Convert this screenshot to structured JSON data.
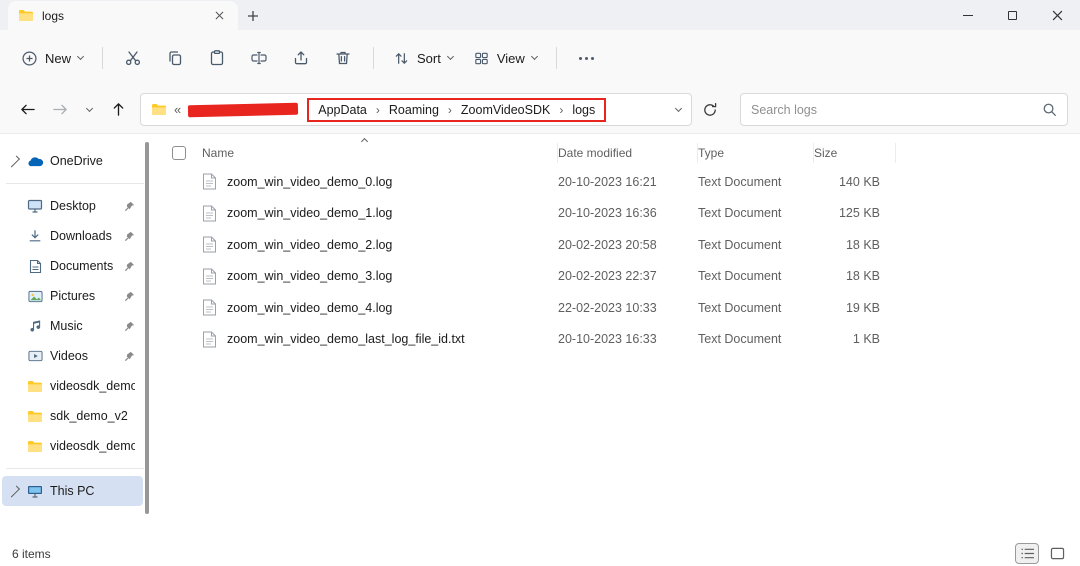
{
  "window": {
    "tab_title": "logs"
  },
  "toolbar": {
    "new_label": "New",
    "sort_label": "Sort",
    "view_label": "View"
  },
  "address": {
    "overflow_indicator": "«",
    "breadcrumbs": [
      "AppData",
      "Roaming",
      "ZoomVideoSDK",
      "logs"
    ],
    "separator": "›",
    "search_placeholder": "Search logs"
  },
  "sidebar": {
    "items": [
      {
        "label": "OneDrive"
      },
      {
        "label": "Desktop"
      },
      {
        "label": "Downloads"
      },
      {
        "label": "Documents"
      },
      {
        "label": "Pictures"
      },
      {
        "label": "Music"
      },
      {
        "label": "Videos"
      },
      {
        "label": "videosdk_demo"
      },
      {
        "label": "sdk_demo_v2"
      },
      {
        "label": "videosdk_demo"
      },
      {
        "label": "This PC"
      }
    ]
  },
  "files": {
    "columns": [
      "Name",
      "Date modified",
      "Type",
      "Size"
    ],
    "rows": [
      {
        "name": "zoom_win_video_demo_0.log",
        "modified": "20-10-2023 16:21",
        "type": "Text Document",
        "size": "140 KB"
      },
      {
        "name": "zoom_win_video_demo_1.log",
        "modified": "20-10-2023 16:36",
        "type": "Text Document",
        "size": "125 KB"
      },
      {
        "name": "zoom_win_video_demo_2.log",
        "modified": "20-02-2023 20:58",
        "type": "Text Document",
        "size": "18 KB"
      },
      {
        "name": "zoom_win_video_demo_3.log",
        "modified": "20-02-2023 22:37",
        "type": "Text Document",
        "size": "18 KB"
      },
      {
        "name": "zoom_win_video_demo_4.log",
        "modified": "22-02-2023 10:33",
        "type": "Text Document",
        "size": "19 KB"
      },
      {
        "name": "zoom_win_video_demo_last_log_file_id.txt",
        "modified": "20-10-2023 16:33",
        "type": "Text Document",
        "size": "1 KB"
      }
    ]
  },
  "status": {
    "items_count": "6 items"
  },
  "colors": {
    "annotation_red": "#e8251f",
    "selection_blue": "#d5e1f2",
    "folder_yellow": "#ffca28"
  }
}
